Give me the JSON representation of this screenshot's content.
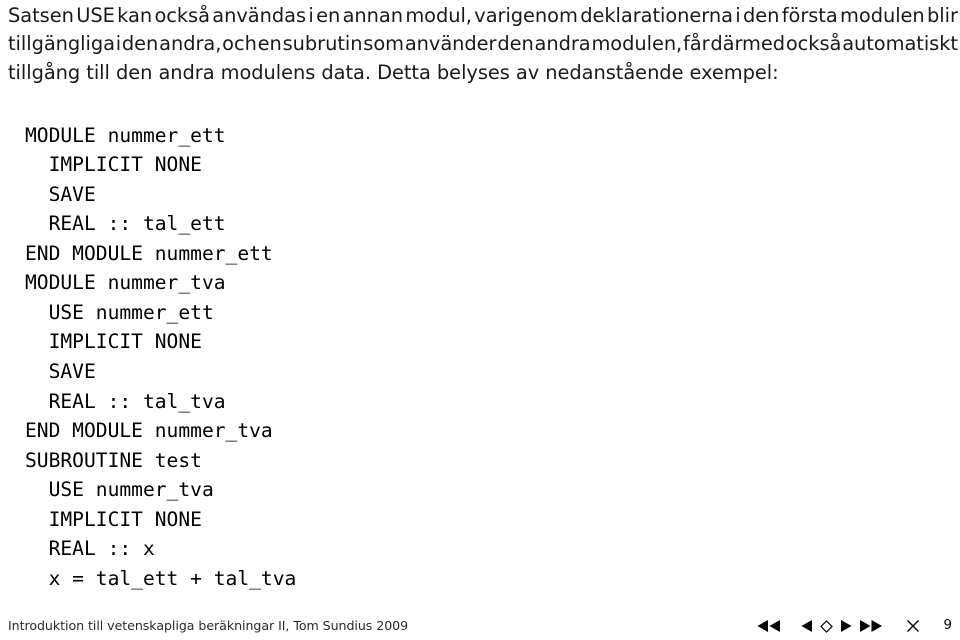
{
  "slide": {
    "paragraph": {
      "full_text": "Satsen USE kan också användas i en annan modul, varigenom deklarationerna i den första modulen blir tillgängliga i den andra, och en subrutin som använder den andra modulen, får därmed också automatiskt tillgång till den andra modulens data. Detta belyses av nedanstående exempel:",
      "lines": [
        "Satsen USE kan också användas i en annan modul, varigenom deklarationerna i den första modulen blir",
        "tillgängliga i den andra, och en subrutin som använder den andra modulen, får därmed också automatiskt",
        "tillgång till den andra modulens data. Detta belyses av nedanstående exempel:"
      ],
      "line1_words": [
        "Satsen",
        "USE",
        "kan",
        "också",
        "användas",
        "i",
        "en",
        "annan",
        "modul,",
        "varigenom",
        "deklarationerna",
        "i",
        "den",
        "första",
        "modulen",
        "blir"
      ],
      "line2_words": [
        "tillgängliga",
        "i",
        "den",
        "andra,",
        "och",
        "en",
        "subrutin",
        "som",
        "använder",
        "den",
        "andra",
        "modulen,",
        "får",
        "därmed",
        "också",
        "automatiskt"
      ],
      "line3": "tillgång till den andra modulens data. Detta belyses av nedanstående exempel:"
    },
    "code": {
      "language": "Fortran",
      "lines": [
        "MODULE nummer_ett",
        "  IMPLICIT NONE",
        "  SAVE",
        "  REAL :: tal_ett",
        "END MODULE nummer_ett",
        "MODULE nummer_tva",
        "  USE nummer_ett",
        "  IMPLICIT NONE",
        "  SAVE",
        "  REAL :: tal_tva",
        "END MODULE nummer_tva",
        "SUBROUTINE test",
        "  USE nummer_tva",
        "  IMPLICIT NONE",
        "  REAL :: x",
        "  x = tal_ett + tal_tva"
      ]
    }
  },
  "footer": {
    "title": "Introduktion till vetenskapliga beräkningar II, Tom Sundius 2009",
    "page_number": "9",
    "nav": [
      {
        "name": "first-slide",
        "icon": "double-triangle-left-icon",
        "glyph": "◀◀"
      },
      {
        "name": "previous-slide",
        "icon": "triangle-left-icon",
        "glyph": "◀"
      },
      {
        "name": "current-frame",
        "icon": "diamond-outline-icon",
        "glyph": "◇"
      },
      {
        "name": "next-slide",
        "icon": "triangle-right-icon",
        "glyph": "▶"
      },
      {
        "name": "last-slide",
        "icon": "double-triangle-right-icon",
        "glyph": "▶▶"
      },
      {
        "name": "close-presentation",
        "icon": "close-x-icon",
        "glyph": "✕"
      }
    ]
  },
  "colors": {
    "background": "#ffffff",
    "body_text": "#1a1a1a",
    "code_text": "#000000",
    "footer_text": "#2b2b2b",
    "nav_icon": "#000000"
  }
}
